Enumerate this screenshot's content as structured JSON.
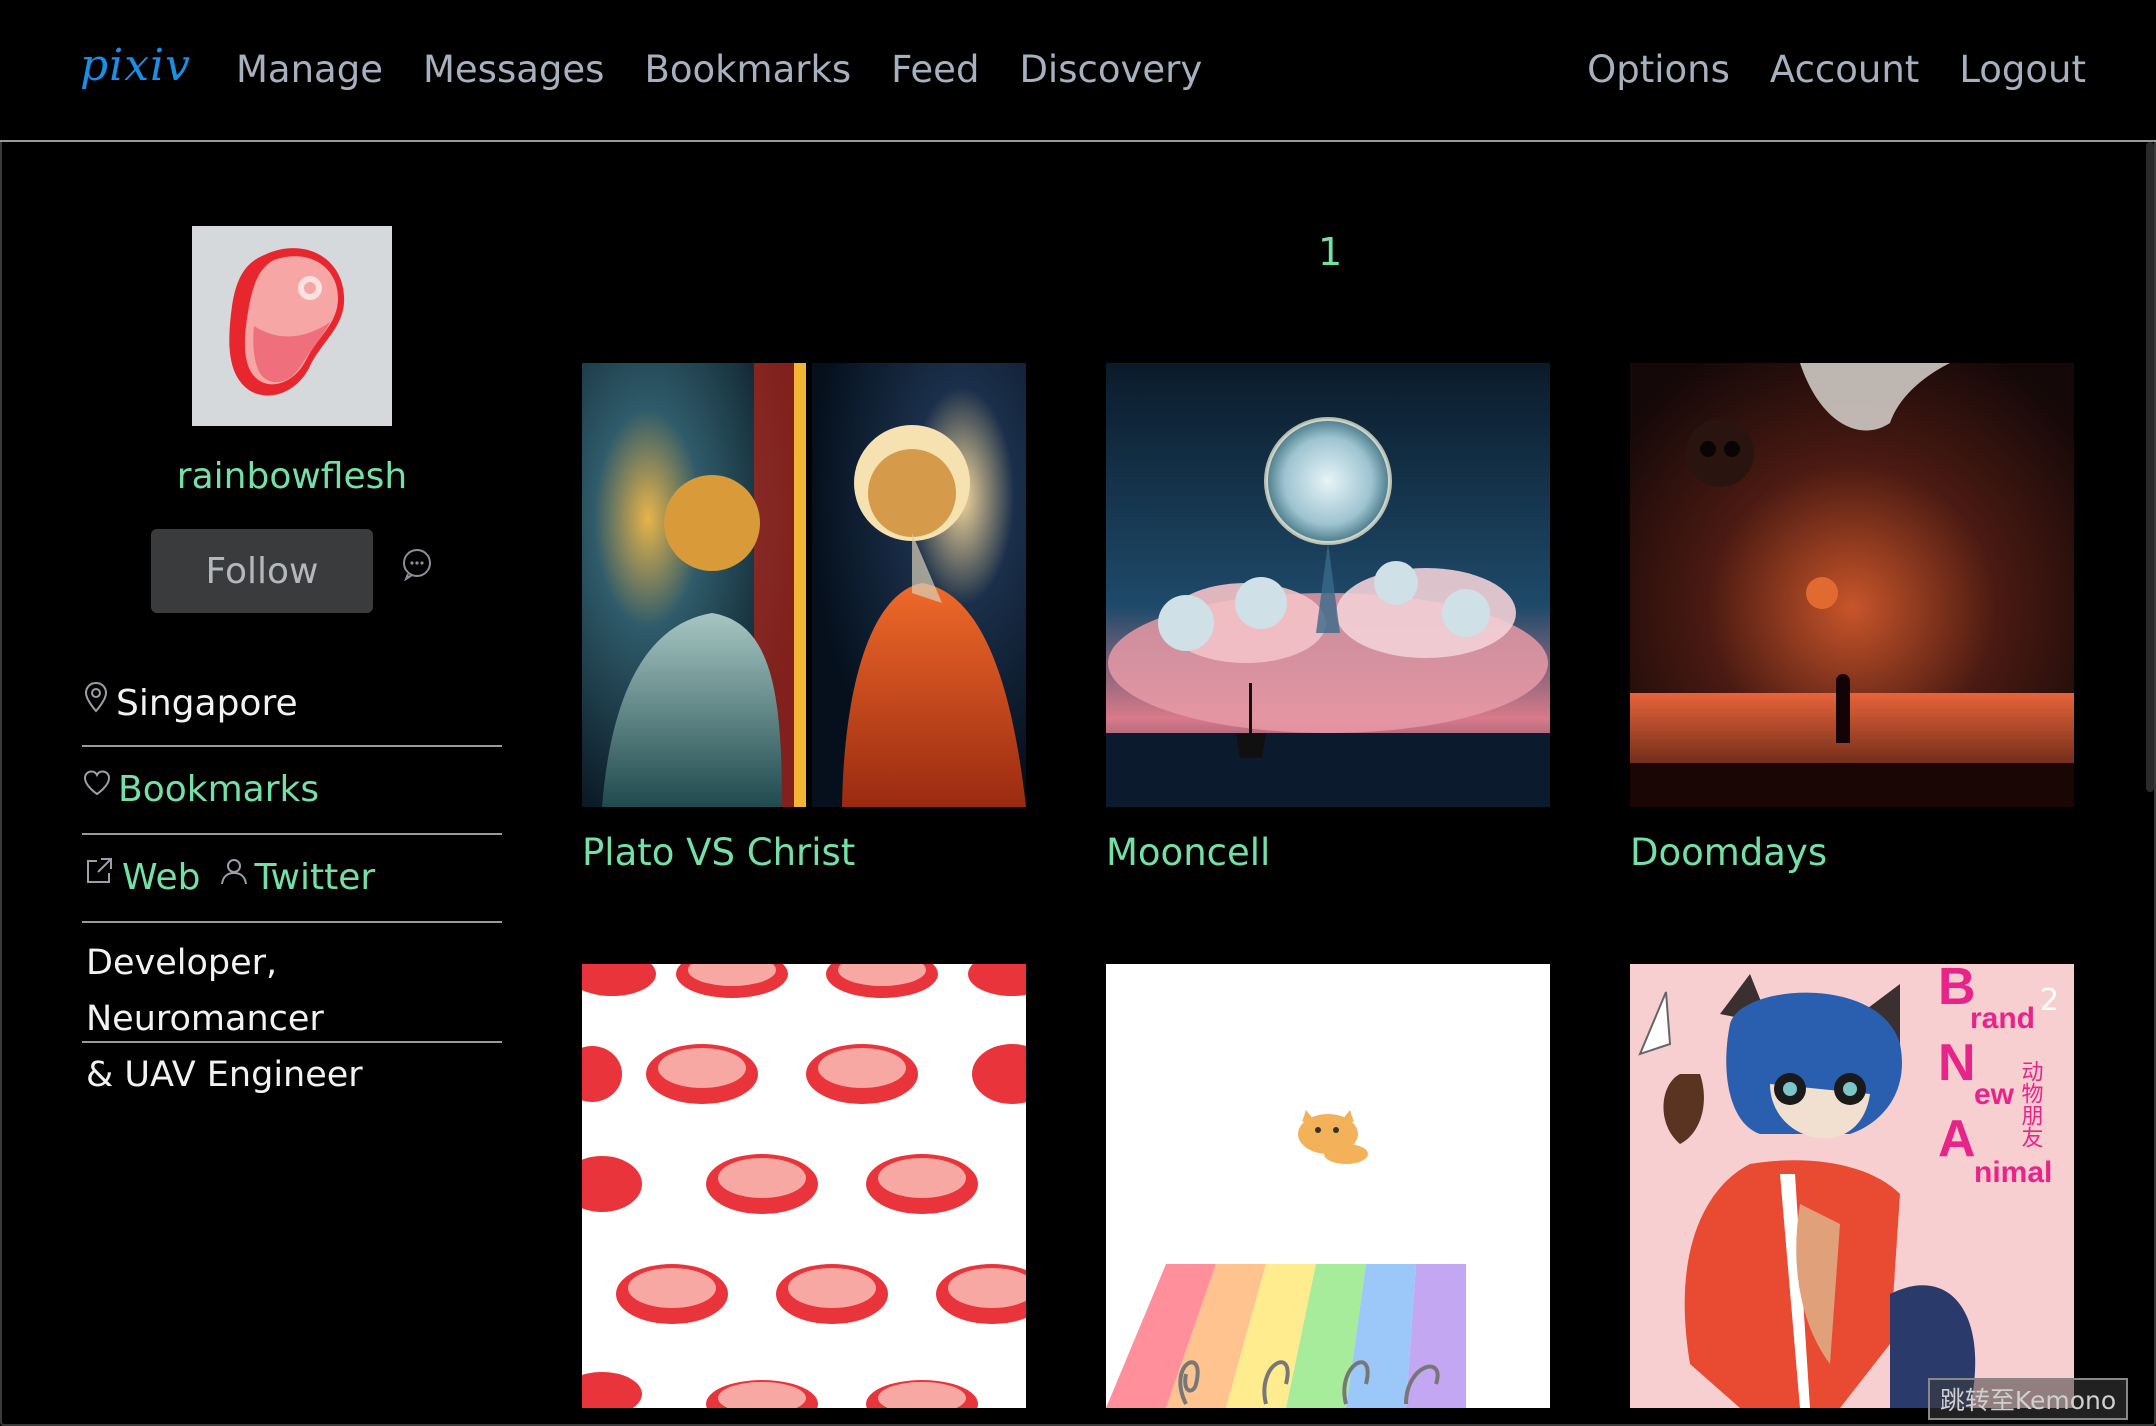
{
  "nav": {
    "logo": "pixiv",
    "left_links": [
      "Manage",
      "Messages",
      "Bookmarks",
      "Feed",
      "Discovery"
    ],
    "right_links": [
      "Options",
      "Account",
      "Logout"
    ]
  },
  "profile": {
    "username": "rainbowflesh",
    "follow_label": "Follow",
    "location": "Singapore",
    "bookmarks_label": "Bookmarks",
    "web_label": "Web",
    "twitter_label": "Twitter",
    "bio_line1": "Developer, Neuromancer",
    "bio_line2": "& UAV Engineer"
  },
  "pagination": {
    "current": "1"
  },
  "works": [
    {
      "title": "Plato VS Christ"
    },
    {
      "title": "Mooncell"
    },
    {
      "title": "Doomdays"
    },
    {
      "title": ""
    },
    {
      "title": ""
    },
    {
      "title": "",
      "page_badge": "2",
      "cover_text": {
        "l1": "B",
        "l1b": "rand",
        "l2": "N",
        "l2b": "ew",
        "l3": "A",
        "l3b": "nimal",
        "cjk": "动物朋友"
      }
    }
  ],
  "kemono_button": "跳转至Kemono",
  "colors": {
    "accent_green": "#74e0a8",
    "logo_blue": "#1a8fe6",
    "nav_gray": "#a7b0be",
    "background": "#000000"
  }
}
